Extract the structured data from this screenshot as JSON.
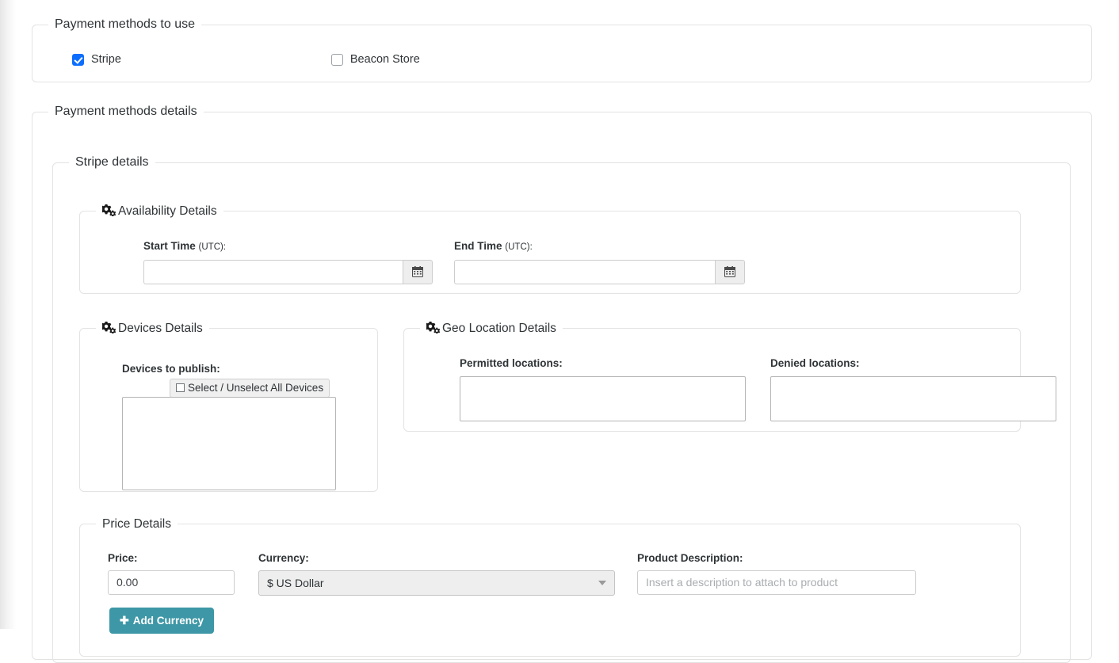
{
  "payment_methods": {
    "legend": "Payment methods to use",
    "options": [
      {
        "label": "Stripe",
        "checked": true
      },
      {
        "label": "Beacon Store",
        "checked": false
      }
    ]
  },
  "payment_details": {
    "legend": "Payment methods details",
    "stripe": {
      "legend": "Stripe details",
      "availability": {
        "legend": "Availability Details",
        "icon": "cogs-icon",
        "start_time": {
          "label": "Start Time",
          "label_suffix": "(UTC):",
          "value": "",
          "placeholder": "",
          "button_icon": "calendar-icon"
        },
        "end_time": {
          "label": "End Time",
          "label_suffix": "(UTC):",
          "value": "",
          "placeholder": "",
          "button_icon": "calendar-icon"
        }
      },
      "devices": {
        "legend": "Devices Details",
        "icon": "cogs-icon",
        "label": "Devices to publish:",
        "select_all_label": "Select / Unselect All Devices",
        "select_all_checked": false,
        "items": []
      },
      "geo_location": {
        "legend": "Geo Location Details",
        "icon": "cogs-icon",
        "permitted": {
          "label": "Permitted locations:",
          "items": []
        },
        "denied": {
          "label": "Denied locations:",
          "items": []
        }
      },
      "price": {
        "legend": "Price Details",
        "price": {
          "label": "Price:",
          "value": "0.00"
        },
        "currency": {
          "label": "Currency:",
          "selected": "$ US Dollar"
        },
        "product_description": {
          "label": "Product Description:",
          "value": "",
          "placeholder": "Insert a description to attach to product"
        },
        "add_currency_button": {
          "label": "Add Currency",
          "icon": "plus-icon",
          "color": "#3d97a6"
        }
      }
    }
  },
  "colors": {
    "checkbox_checked": "#0d6efd",
    "button_teal": "#3d97a6",
    "border": "#e3e3e3",
    "input_border": "#cdcdcd"
  }
}
